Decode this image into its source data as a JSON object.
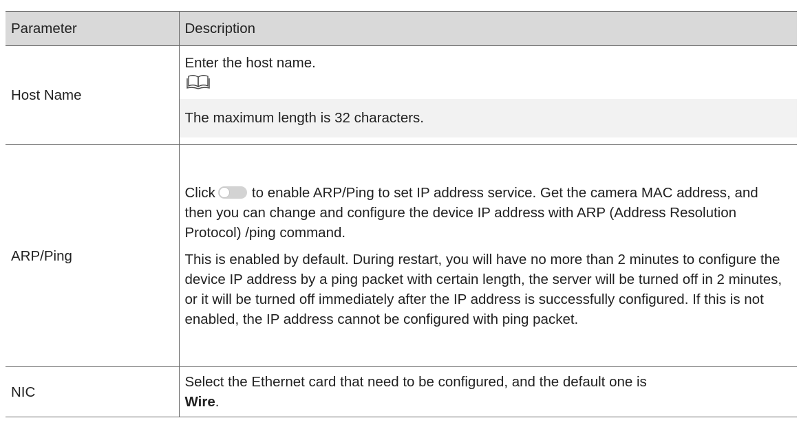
{
  "table": {
    "headers": {
      "parameter": "Parameter",
      "description": "Description"
    },
    "rows": {
      "host_name": {
        "parameter": "Host Name",
        "description": "Enter the host name.",
        "note_icon": "book-note-icon",
        "note": "The maximum length is 32 characters."
      },
      "arp_ping": {
        "parameter": "ARP/Ping",
        "p1_before_toggle": "Click",
        "toggle_icon": "toggle-switch-icon",
        "p1_after_toggle": "to enable ARP/Ping to set IP address service. Get the camera MAC address, and then you can change and configure the device IP address with ARP (Address Resolution Protocol) /ping command.",
        "p2": "This is enabled by default. During restart, you will have no more than 2 minutes to configure the device IP address by a ping packet with certain length, the server will be turned off in 2 minutes, or it will be turned off immediately after the IP address is successfully configured. If this is not enabled, the IP address cannot be configured with ping packet."
      },
      "nic": {
        "parameter": "NIC",
        "description_before_bold": "Select the Ethernet card that need to be configured, and the default one is",
        "bold_value": "Wire",
        "description_after_bold": "."
      }
    }
  }
}
